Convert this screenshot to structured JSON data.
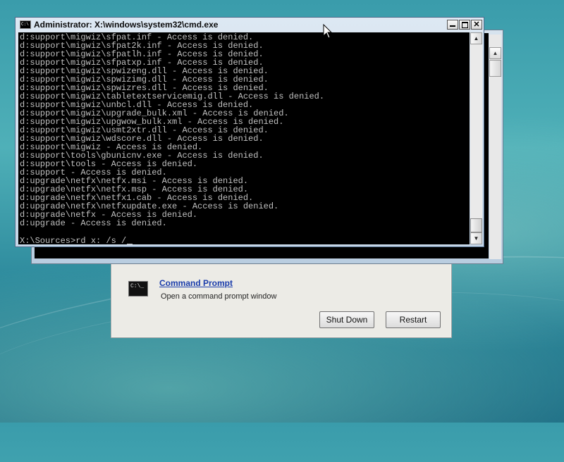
{
  "cmd_window": {
    "title": "Administrator: X:\\windows\\system32\\cmd.exe",
    "icon": "cmd-icon",
    "output_lines": [
      "d:support\\migwiz\\sfpat.inf - Access is denied.",
      "d:support\\migwiz\\sfpat2k.inf - Access is denied.",
      "d:support\\migwiz\\sfpatlh.inf - Access is denied.",
      "d:support\\migwiz\\sfpatxp.inf - Access is denied.",
      "d:support\\migwiz\\spwizeng.dll - Access is denied.",
      "d:support\\migwiz\\spwizimg.dll - Access is denied.",
      "d:support\\migwiz\\spwizres.dll - Access is denied.",
      "d:support\\migwiz\\tabletextservicemig.dll - Access is denied.",
      "d:support\\migwiz\\unbcl.dll - Access is denied.",
      "d:support\\migwiz\\upgrade_bulk.xml - Access is denied.",
      "d:support\\migwiz\\upgwow_bulk.xml - Access is denied.",
      "d:support\\migwiz\\usmt2xtr.dll - Access is denied.",
      "d:support\\migwiz\\wdscore.dll - Access is denied.",
      "d:support\\migwiz - Access is denied.",
      "d:support\\tools\\gbunicnv.exe - Access is denied.",
      "d:support\\tools - Access is denied.",
      "d:support - Access is denied.",
      "d:upgrade\\netfx\\netfx.msi - Access is denied.",
      "d:upgrade\\netfx\\netfx.msp - Access is denied.",
      "d:upgrade\\netfx\\netfx1.cab - Access is denied.",
      "d:upgrade\\netfx\\netfxupdate.exe - Access is denied.",
      "d:upgrade\\netfx - Access is denied.",
      "d:upgrade - Access is denied."
    ],
    "prompt": "X:\\Sources>rd x: /s /"
  },
  "recovery_dialog": {
    "option_title": "Command Prompt",
    "option_description": "Open a command prompt window",
    "option_icon_text": "C:\\_",
    "shutdown_label": "Shut Down",
    "restart_label": "Restart"
  },
  "colors": {
    "console_bg": "#000000",
    "console_text": "#c0c0c0",
    "link": "#1a3cab",
    "desktop": "#3a9cab"
  }
}
